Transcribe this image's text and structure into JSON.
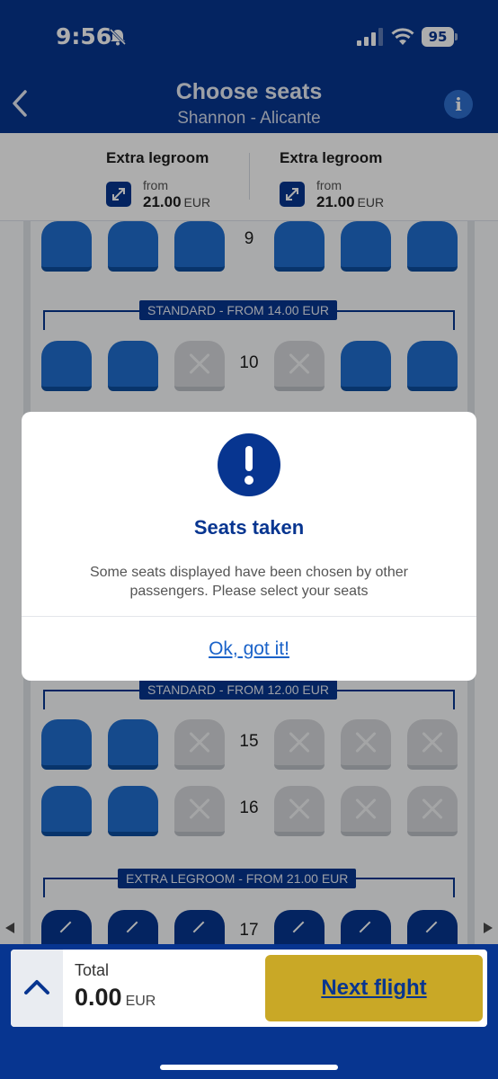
{
  "status_bar": {
    "time": "9:56",
    "battery": "95"
  },
  "header": {
    "title": "Choose seats",
    "subtitle": "Shannon - Alicante",
    "info_label": "i"
  },
  "legend": [
    {
      "title": "Extra legroom",
      "from_label": "from",
      "price": "21.00",
      "currency": "EUR"
    },
    {
      "title": "Extra legroom",
      "from_label": "from",
      "price": "21.00",
      "currency": "EUR"
    }
  ],
  "seat_map": {
    "rows": [
      {
        "number": "9",
        "seats": [
          "available",
          "available",
          "available",
          "available",
          "available",
          "available"
        ]
      },
      {
        "number": "10",
        "seats": [
          "available",
          "available",
          "taken",
          "taken",
          "available",
          "available"
        ]
      },
      {
        "number": "15",
        "seats": [
          "available",
          "available",
          "taken",
          "taken",
          "taken",
          "taken"
        ]
      },
      {
        "number": "16",
        "seats": [
          "available",
          "available",
          "taken",
          "taken",
          "taken",
          "taken"
        ]
      },
      {
        "number": "17",
        "seats": [
          "extra",
          "extra",
          "extra",
          "extra",
          "extra",
          "extra"
        ]
      }
    ],
    "sections": [
      {
        "label": "STANDARD - FROM 14.00 EUR"
      },
      {
        "label": "STANDARD - FROM 12.00 EUR"
      },
      {
        "label": "EXTRA LEGROOM - FROM 21.00 EUR"
      }
    ]
  },
  "dialog": {
    "title": "Seats taken",
    "message": "Some seats displayed have been chosen by other passengers. Please select your seats",
    "button_label": "Ok, got it!"
  },
  "footer": {
    "total_label": "Total",
    "total_amount": "0.00",
    "total_currency": "EUR",
    "next_button_label": "Next flight"
  },
  "colors": {
    "brand_blue": "#073590",
    "seat_available": "#1f6ecf",
    "seat_taken": "#d6d8dc",
    "cta_yellow": "#c9a826",
    "link_blue": "#1b63c9"
  }
}
